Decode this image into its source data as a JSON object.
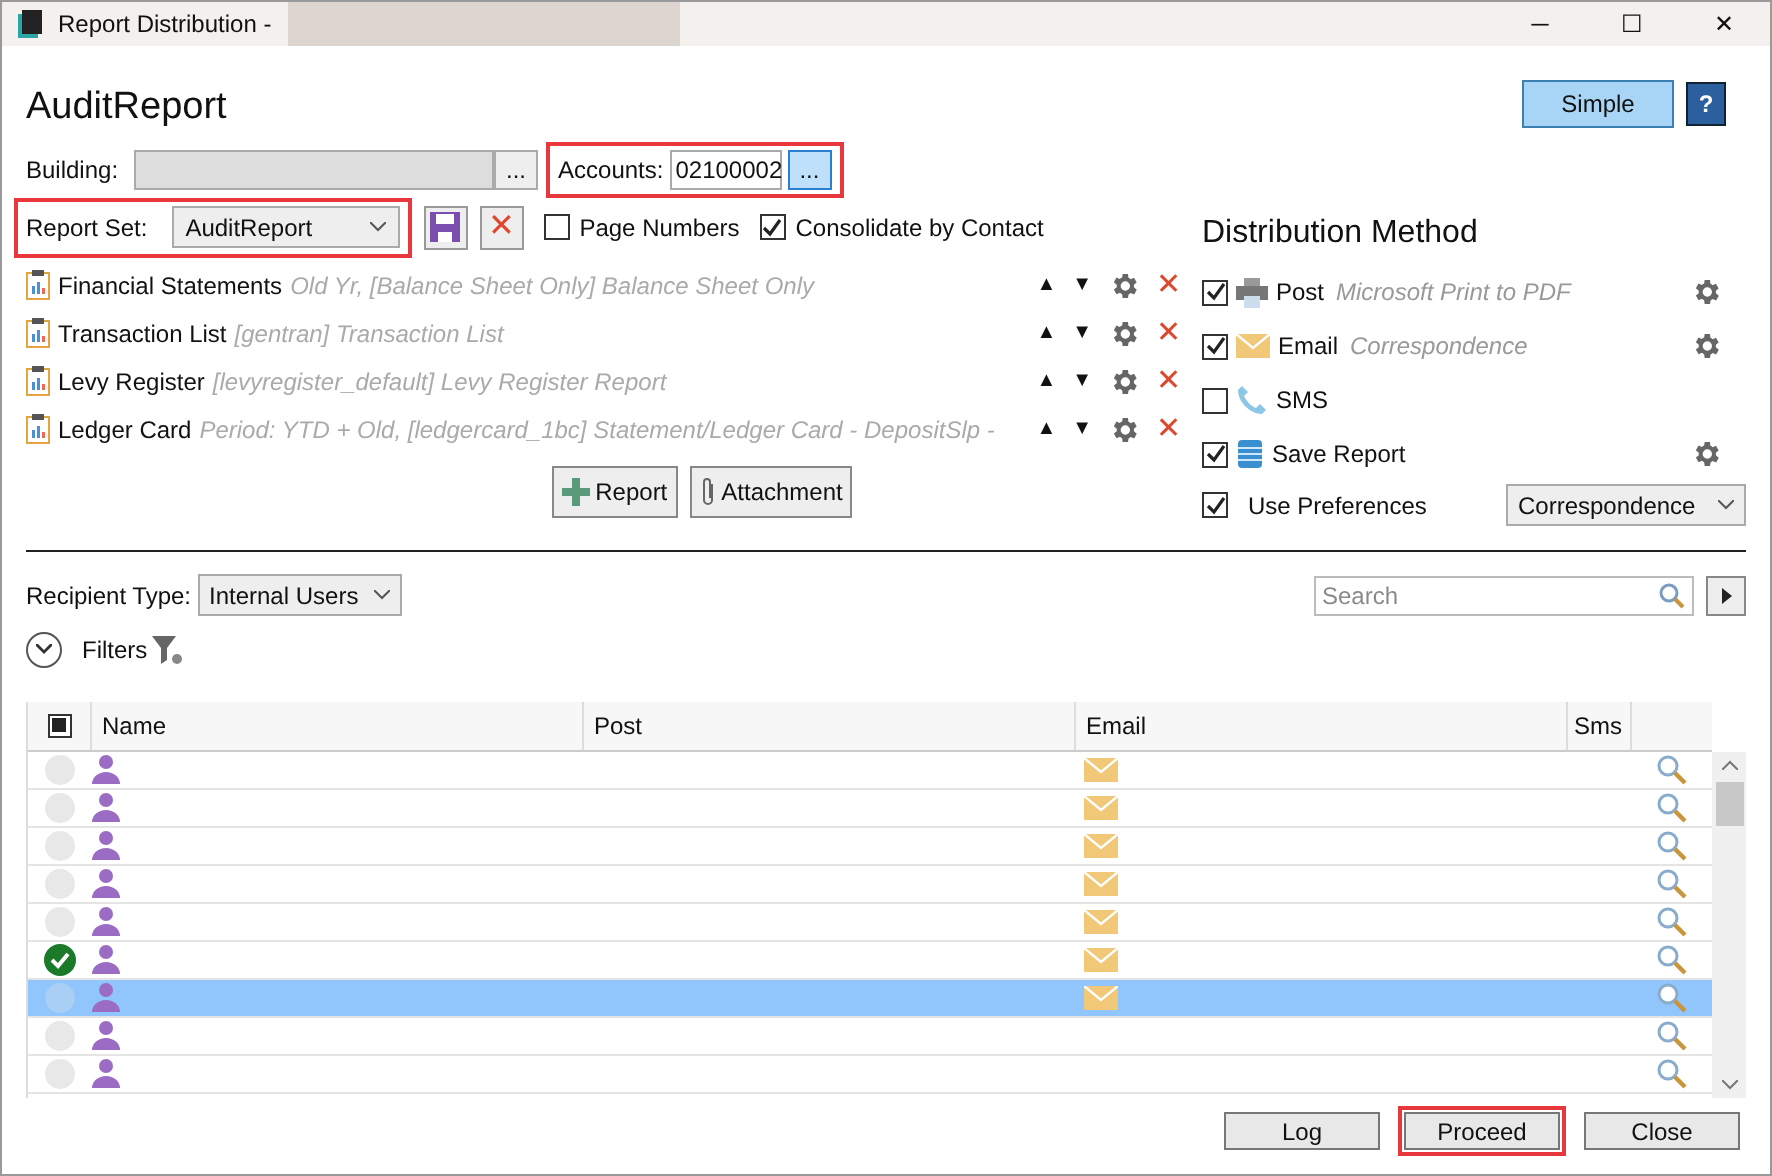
{
  "window": {
    "title": "Report Distribution -",
    "buttons": [
      "─",
      "☐",
      "✕"
    ]
  },
  "heading": "AuditReport",
  "simple_button": "Simple",
  "help_button": "?",
  "building": {
    "label": "Building:",
    "browse": "..."
  },
  "accounts": {
    "label": "Accounts:",
    "value": "02100002",
    "browse": "...",
    "highlighted": true
  },
  "report_set": {
    "label": "Report Set:",
    "value": "AuditReport",
    "highlighted": true
  },
  "options": [
    {
      "label": "Page Numbers",
      "checked": false
    },
    {
      "label": "Consolidate by Contact",
      "checked": true
    }
  ],
  "reports": [
    {
      "name": "Financial Statements",
      "detail": "Old Yr, [Balance Sheet Only] Balance Sheet Only"
    },
    {
      "name": "Transaction List",
      "detail": "[gentran] Transaction List"
    },
    {
      "name": "Levy Register",
      "detail": "[levyregister_default] Levy Register Report"
    },
    {
      "name": "Ledger Card",
      "detail": "Period: YTD + Old, [ledgercard_1bc] Statement/Ledger Card - DepositSlp -"
    }
  ],
  "report_actions": {
    "up": "▲",
    "down": "▼",
    "remove": "✕"
  },
  "add_buttons": [
    {
      "kind": "report",
      "label": "Report"
    },
    {
      "kind": "attachment",
      "label": "Attachment"
    }
  ],
  "distribution": {
    "title": "Distribution Method",
    "methods": [
      {
        "kind": "post",
        "label": "Post",
        "detail": "Microsoft Print to PDF",
        "checked": true,
        "settings": true
      },
      {
        "kind": "email",
        "label": "Email",
        "detail": "Correspondence",
        "checked": true,
        "settings": true
      },
      {
        "kind": "sms",
        "label": "SMS",
        "checked": false,
        "settings": false
      },
      {
        "kind": "save",
        "label": "Save Report",
        "checked": true,
        "settings": true
      }
    ],
    "preferences": {
      "label": "Use Preferences",
      "checked": true,
      "value": "Correspondence"
    }
  },
  "recipient_type": {
    "label": "Recipient Type:",
    "value": "Internal Users"
  },
  "search": {
    "placeholder": "Search"
  },
  "filters": {
    "label": "Filters",
    "expanded": false
  },
  "table": {
    "select_all": {
      "checked": true
    },
    "columns": [
      "Name",
      "Post",
      "Email",
      "Sms"
    ],
    "rows": [
      {
        "checked": false,
        "selected": false,
        "email": true
      },
      {
        "checked": false,
        "selected": false,
        "email": true
      },
      {
        "checked": false,
        "selected": false,
        "email": true
      },
      {
        "checked": false,
        "selected": false,
        "email": true
      },
      {
        "checked": false,
        "selected": false,
        "email": true
      },
      {
        "checked": true,
        "selected": false,
        "email": true
      },
      {
        "checked": false,
        "selected": true,
        "email": true
      },
      {
        "checked": false,
        "selected": false,
        "email": false
      },
      {
        "checked": false,
        "selected": false,
        "email": false
      }
    ]
  },
  "footer": [
    {
      "label": "Log",
      "highlighted": false
    },
    {
      "label": "Proceed",
      "highlighted": true
    },
    {
      "label": "Close",
      "highlighted": false
    }
  ]
}
